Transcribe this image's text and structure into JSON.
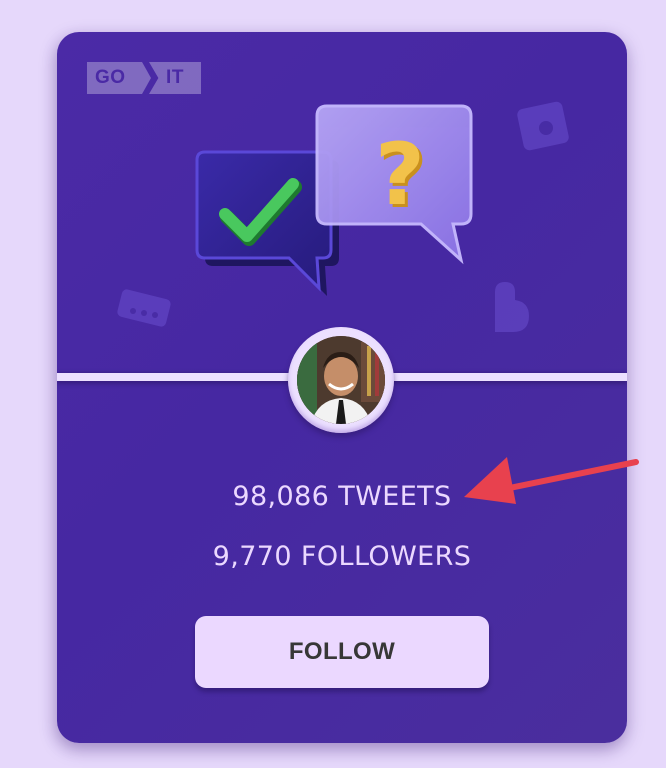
{
  "card": {
    "logo": {
      "part1": "GO",
      "part2": "IT"
    },
    "stats": {
      "tweets": "98,086 TWEETS",
      "followers": "9,770 FOLLOWERS"
    },
    "follow_button_label": "FOLLOW"
  },
  "colors": {
    "page_bg": "#e6d8fb",
    "card_gradient": "#4b2aa6",
    "accent_light": "#ebd8ff",
    "button_text": "#373737",
    "annotation_arrow": "#e8414e"
  },
  "icons": [
    "chat-check-bubble-icon",
    "chat-question-bubble-icon",
    "avatar-photo",
    "annotation-arrow-icon"
  ]
}
